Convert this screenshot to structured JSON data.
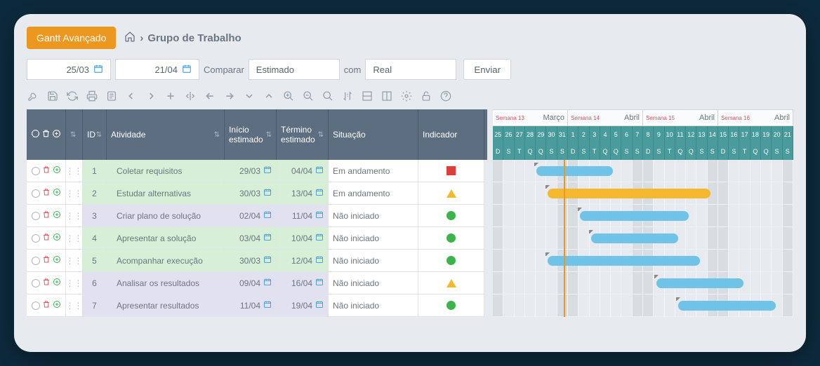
{
  "topbar": {
    "primary_btn": "Gantt Avançado",
    "breadcrumb": "Grupo de Trabalho"
  },
  "filter": {
    "date_from": "25/03",
    "date_to": "21/04",
    "compare_lbl": "Comparar",
    "compare_val": "Estimado",
    "with_lbl": "com",
    "with_val": "Real",
    "send": "Enviar"
  },
  "columns": {
    "id": "ID",
    "atv": "Atividade",
    "ini": "Início estimado",
    "fim": "Término estimado",
    "sit": "Situação",
    "ind": "Indicador"
  },
  "rows": [
    {
      "id": "1",
      "atv": "Coletar requisitos",
      "ini": "29/03",
      "fim": "04/04",
      "sit": "Em andamento",
      "ind": "sq",
      "shade": "green",
      "bar": {
        "start": 4,
        "span": 7,
        "color": "blue"
      }
    },
    {
      "id": "2",
      "atv": "Estudar alternativas",
      "ini": "30/03",
      "fim": "13/04",
      "sit": "Em andamento",
      "ind": "tri",
      "shade": "green",
      "bar": {
        "start": 5,
        "span": 15,
        "color": "yellow"
      }
    },
    {
      "id": "3",
      "atv": "Criar plano de solução",
      "ini": "02/04",
      "fim": "11/04",
      "sit": "Não iniciado",
      "ind": "circ",
      "shade": "purple",
      "bar": {
        "start": 8,
        "span": 10,
        "color": "blue"
      }
    },
    {
      "id": "4",
      "atv": "Apresentar a solução",
      "ini": "03/04",
      "fim": "10/04",
      "sit": "Não iniciado",
      "ind": "circ",
      "shade": "green",
      "bar": {
        "start": 9,
        "span": 8,
        "color": "blue"
      }
    },
    {
      "id": "5",
      "atv": "Acompanhar execução",
      "ini": "30/03",
      "fim": "12/04",
      "sit": "Não iniciado",
      "ind": "circ",
      "shade": "green",
      "bar": {
        "start": 5,
        "span": 14,
        "color": "blue"
      }
    },
    {
      "id": "6",
      "atv": "Analisar os resultados",
      "ini": "09/04",
      "fim": "16/04",
      "sit": "Não iniciado",
      "ind": "tri",
      "shade": "purple",
      "bar": {
        "start": 15,
        "span": 8,
        "color": "blue"
      }
    },
    {
      "id": "7",
      "atv": "Apresentar resultados",
      "ini": "11/04",
      "fim": "19/04",
      "sit": "Não iniciado",
      "ind": "circ",
      "shade": "purple",
      "bar": {
        "start": 17,
        "span": 9,
        "color": "blue"
      }
    }
  ],
  "timeline": {
    "months": [
      {
        "week": "Semana 13",
        "label": "Março",
        "span": 7
      },
      {
        "week": "Semana 14",
        "label": "Abril",
        "span": 7
      },
      {
        "week": "Semana 15",
        "label": "Abril",
        "span": 7
      },
      {
        "week": "Semana 16",
        "label": "Abril",
        "span": 7
      }
    ],
    "days": [
      "25",
      "26",
      "27",
      "28",
      "29",
      "30",
      "31",
      "1",
      "2",
      "3",
      "4",
      "5",
      "6",
      "7",
      "8",
      "9",
      "10",
      "11",
      "12",
      "13",
      "14",
      "15",
      "16",
      "17",
      "18",
      "19",
      "20",
      "21"
    ],
    "dow": [
      "D",
      "S",
      "T",
      "Q",
      "Q",
      "S",
      "S",
      "D",
      "S",
      "T",
      "Q",
      "Q",
      "S",
      "S",
      "D",
      "S",
      "T",
      "Q",
      "Q",
      "S",
      "S",
      "D",
      "S",
      "T",
      "Q",
      "Q",
      "S",
      "S"
    ],
    "weekend_idx": [
      0,
      6,
      7,
      13,
      14,
      20,
      21,
      27
    ],
    "today_idx": 6
  }
}
